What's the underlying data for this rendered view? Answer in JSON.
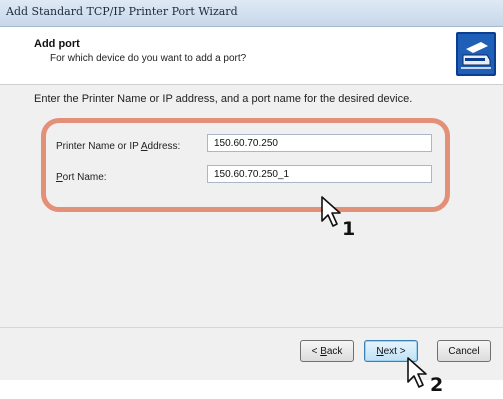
{
  "window": {
    "title": "Add Standard TCP/IP Printer Port Wizard"
  },
  "header": {
    "title": "Add port",
    "subtitle": "For which device do you want to add a port?",
    "icon": "printer-network-icon"
  },
  "instruction": "Enter the Printer Name or IP address, and a port name for the desired device.",
  "form": {
    "printer_label_before": "Printer Name or ",
    "printer_label_access": "IP ",
    "printer_label_mid": "",
    "printer_label_key": "A",
    "printer_label_after": "ddress:",
    "printer_value": "150.60.70.250",
    "port_label_key": "P",
    "port_label_after": "ort Name:",
    "port_value": "150.60.70.250_1"
  },
  "buttons": {
    "back_key": "B",
    "back_before": "< ",
    "back_after": "ack",
    "next_key": "N",
    "next_after": "ext >",
    "cancel": "Cancel"
  },
  "annotations": {
    "step1": "1",
    "step2": "2",
    "highlight_color": "#e39079"
  }
}
